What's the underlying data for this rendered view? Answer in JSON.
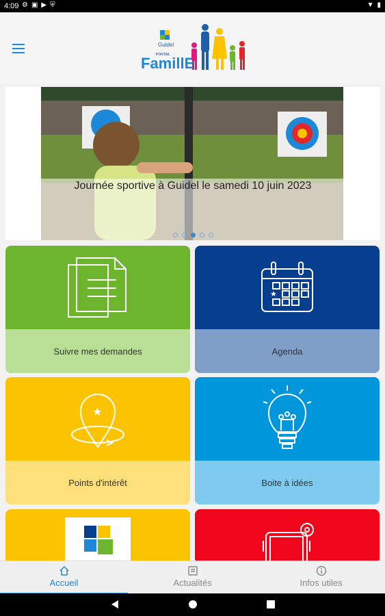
{
  "status_bar": {
    "time": "4:09",
    "left_icons": [
      "gear-icon",
      "square-icon",
      "play-icon",
      "shield-icon"
    ],
    "right_icons": [
      "wifi-icon",
      "battery-icon"
    ]
  },
  "header": {
    "logo_top_text": "Guidel",
    "logo_portal_text": "PORTAIL",
    "logo_brand_text": "FamillE"
  },
  "carousel": {
    "caption": "Journée sportive à Guidel le samedi 10 juin 2023",
    "slide_count": 5,
    "active_slide": 3
  },
  "tiles": [
    {
      "label": "Suivre mes demandes",
      "icon": "documents-icon",
      "color": "#6db52d"
    },
    {
      "label": "Agenda",
      "icon": "calendar-icon",
      "color": "#063f90"
    },
    {
      "label": "Points d'intérêt",
      "icon": "map-pin-star-icon",
      "color": "#fcc400"
    },
    {
      "label": "Boite à idées",
      "icon": "lightbulb-icon",
      "color": "#0096dc"
    },
    {
      "label": "",
      "icon": "guidel-logo-icon",
      "color": "#fcc400"
    },
    {
      "label": "",
      "icon": "print-settings-icon",
      "color": "#f0061a"
    }
  ],
  "bottom_nav": {
    "items": [
      {
        "label": "Accueil",
        "icon": "home-icon",
        "active": true
      },
      {
        "label": "Actualités",
        "icon": "news-icon",
        "active": false
      },
      {
        "label": "Infos utiles",
        "icon": "info-icon",
        "active": false
      }
    ]
  },
  "colors": {
    "accent": "#1e88d8"
  }
}
